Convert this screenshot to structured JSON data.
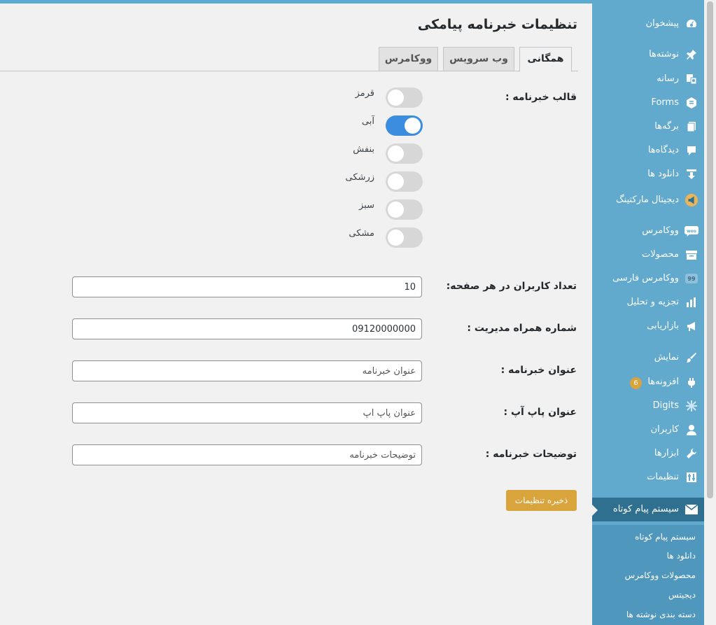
{
  "page": {
    "title": "تنظیمات خبرنامه پیامکی"
  },
  "tabs": [
    {
      "label": "همگانی",
      "active": true
    },
    {
      "label": "وب سرویس",
      "active": false
    },
    {
      "label": "ووکامرس",
      "active": false
    }
  ],
  "template": {
    "label": "قالب خبرنامه :",
    "options": [
      {
        "label": "قرمز",
        "on": false
      },
      {
        "label": "آبی",
        "on": true
      },
      {
        "label": "بنفش",
        "on": false
      },
      {
        "label": "زرشکی",
        "on": false
      },
      {
        "label": "سبز",
        "on": false
      },
      {
        "label": "مشکی",
        "on": false
      }
    ]
  },
  "fields": {
    "users_per_page": {
      "label": "تعداد کاربران در هر صفحه:",
      "value": "10"
    },
    "admin_mobile": {
      "label": "شماره همراه مدیریت :",
      "value": "09120000000"
    },
    "newsletter_title": {
      "label": "عنوان خبرنامه :",
      "placeholder": "عنوان خبرنامه"
    },
    "popup_title": {
      "label": "عنوان پاپ آپ :",
      "placeholder": "عنوان پاپ آپ"
    },
    "newsletter_desc": {
      "label": "توضیحات خبرنامه :",
      "placeholder": "توضیحات خبرنامه"
    }
  },
  "save_button": "ذخیره تنظیمات",
  "sidebar": {
    "items": [
      {
        "label": "پیشخوان",
        "icon": "dashboard-icon"
      },
      {
        "label": "نوشته‌ها",
        "icon": "pin-icon"
      },
      {
        "label": "رسانه",
        "icon": "media-icon"
      },
      {
        "label": "Forms",
        "icon": "forms-icon"
      },
      {
        "label": "برگه‌ها",
        "icon": "pages-icon"
      },
      {
        "label": "دیدگاه‌ها",
        "icon": "comments-icon"
      },
      {
        "label": "دانلود ها",
        "icon": "download-icon"
      },
      {
        "label": "دیجیتال مارکتینگ",
        "icon": "megaphone-icon"
      },
      {
        "label": "ووکامرس",
        "icon": "woo-icon"
      },
      {
        "label": "محصولات",
        "icon": "archive-icon"
      },
      {
        "label": "ووکامرس فارسی",
        "icon": "persian-woo-icon"
      },
      {
        "label": "تجزیه و تحلیل",
        "icon": "bar-chart-icon"
      },
      {
        "label": "بازاریابی",
        "icon": "marketing-icon"
      },
      {
        "label": "نمایش",
        "icon": "brush-icon"
      },
      {
        "label": "افزونه‌ها",
        "icon": "plugin-icon",
        "badge": "6"
      },
      {
        "label": "Digits",
        "icon": "digits-icon"
      },
      {
        "label": "کاربران",
        "icon": "user-icon"
      },
      {
        "label": "ابزارها",
        "icon": "wrench-icon"
      },
      {
        "label": "تنظیمات",
        "icon": "settings-icon"
      },
      {
        "label": "سیستم پیام کوتاه",
        "icon": "mail-icon",
        "active": true
      }
    ],
    "submenu": [
      "سیستم پیام کوتاه",
      "دانلود ها",
      "محصولات ووکامرس",
      "دیجیتس",
      "دسته بندی نوشته ها"
    ]
  },
  "colors": {
    "sidebar": "#61a9cd",
    "sidebar_active": "#2f6f8f",
    "toggle_on": "#3b8de0",
    "accent_button": "#d9a43c"
  }
}
